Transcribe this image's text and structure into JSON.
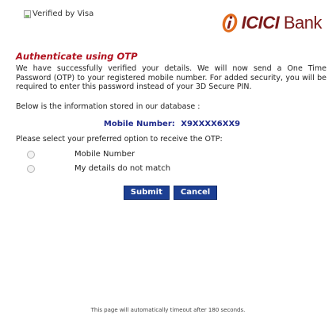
{
  "header": {
    "visa_alt": "Verified by Visa",
    "bank_brand": "ICICI",
    "bank_suffix": "Bank",
    "brand_color": "#7b1a1a"
  },
  "title": "Authenticate using OTP",
  "intro": "We have successfully verified your details. We will now send a One Time Password (OTP) to your registered mobile number. For added security, you will be required to enter this password instead of your 3D Secure PIN.",
  "info_label": "Below is the information stored in our database :",
  "mobile": {
    "label": "Mobile Number:",
    "value": "X9XXXX6XX9"
  },
  "select_label": "Please select your preferred option to receive the OTP:",
  "options": [
    {
      "label": "Mobile Number"
    },
    {
      "label": "My details do not match"
    }
  ],
  "buttons": {
    "submit": "Submit",
    "cancel": "Cancel",
    "color": "#1c3f93"
  },
  "footer": {
    "timeout": "This page will automatically timeout after 180 seconds."
  }
}
